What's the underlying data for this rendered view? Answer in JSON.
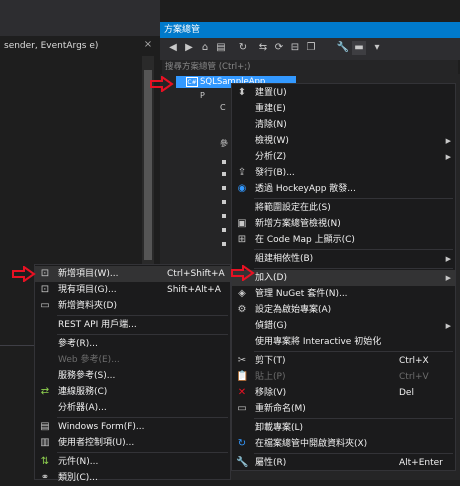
{
  "editor": {
    "code_line": " sender, EventArgs e)",
    "close_glyph": "×"
  },
  "solution_explorer": {
    "title": "方案總管",
    "search_placeholder": "搜尋方案總管 (Ctrl+;)",
    "selected_node": "SQLSampleApp",
    "selected_node_badge": "C#",
    "tree_items": [
      "P",
      "C",
      "",
      "",
      "參"
    ]
  },
  "project_menu": {
    "items": [
      {
        "label": "建置(U)",
        "icon": "build-icon"
      },
      {
        "label": "重建(E)",
        "icon": ""
      },
      {
        "label": "清除(N)",
        "icon": ""
      },
      {
        "label": "檢視(W)",
        "icon": "",
        "submenu": true
      },
      {
        "label": "分析(Z)",
        "icon": "",
        "submenu": true
      },
      {
        "label": "發行(B)...",
        "icon": "publish-icon"
      },
      {
        "label": "透過 HockeyApp 散發...",
        "icon": "hockeyapp-icon"
      },
      {
        "label": "將範圍設定在此(S)",
        "icon": ""
      },
      {
        "label": "新增方案總管檢視(N)",
        "icon": "new-view-icon"
      },
      {
        "label": "在 Code Map 上顯示(C)",
        "icon": "code-map-icon"
      },
      {
        "label": "組建相依性(B)",
        "icon": "",
        "submenu": true
      },
      {
        "label": "加入(D)",
        "icon": "",
        "submenu": true
      },
      {
        "label": "管理 NuGet 套件(N)...",
        "icon": "nuget-icon"
      },
      {
        "label": "設定為啟始專案(A)",
        "icon": "gear-icon"
      },
      {
        "label": "偵錯(G)",
        "icon": "",
        "submenu": true
      },
      {
        "label": "使用專案將 Interactive 初始化",
        "icon": ""
      },
      {
        "label": "剪下(T)",
        "icon": "cut-icon",
        "shortcut": "Ctrl+X"
      },
      {
        "label": "貼上(P)",
        "icon": "paste-icon",
        "shortcut": "Ctrl+V",
        "disabled": true
      },
      {
        "label": "移除(V)",
        "icon": "remove-icon",
        "shortcut": "Del"
      },
      {
        "label": "重新命名(M)",
        "icon": "rename-icon"
      },
      {
        "label": "卸載專案(L)",
        "icon": ""
      },
      {
        "label": "在檔案總管中開啟資料夾(X)",
        "icon": "open-folder-icon"
      },
      {
        "label": "屬性(R)",
        "icon": "wrench-icon",
        "shortcut": "Alt+Enter"
      }
    ]
  },
  "add_menu": {
    "items": [
      {
        "label": "新增項目(W)...",
        "icon": "new-item-icon",
        "shortcut": "Ctrl+Shift+A"
      },
      {
        "label": "現有項目(G)...",
        "icon": "existing-item-icon",
        "shortcut": "Shift+Alt+A"
      },
      {
        "label": "新增資料夾(D)",
        "icon": "new-folder-icon"
      },
      {
        "label": "REST API 用戶端...",
        "icon": ""
      },
      {
        "label": "參考(R)...",
        "icon": ""
      },
      {
        "label": "Web 參考(E)...",
        "icon": "",
        "disabled": true
      },
      {
        "label": "服務參考(S)...",
        "icon": ""
      },
      {
        "label": "連線服務(C)",
        "icon": "connected-service-icon"
      },
      {
        "label": "分析器(A)...",
        "icon": ""
      },
      {
        "label": "Windows Form(F)...",
        "icon": "windows-form-icon"
      },
      {
        "label": "使用者控制項(U)...",
        "icon": "user-control-icon"
      },
      {
        "label": "元件(N)...",
        "icon": "component-icon"
      },
      {
        "label": "類別(C)...",
        "icon": "class-icon"
      }
    ]
  },
  "colors": {
    "title_bar": "#007acc",
    "selection": "#3399ff",
    "menu_bg": "#1b1b1c",
    "highlight": "#333334",
    "annotation_arrow": "#e81123"
  }
}
